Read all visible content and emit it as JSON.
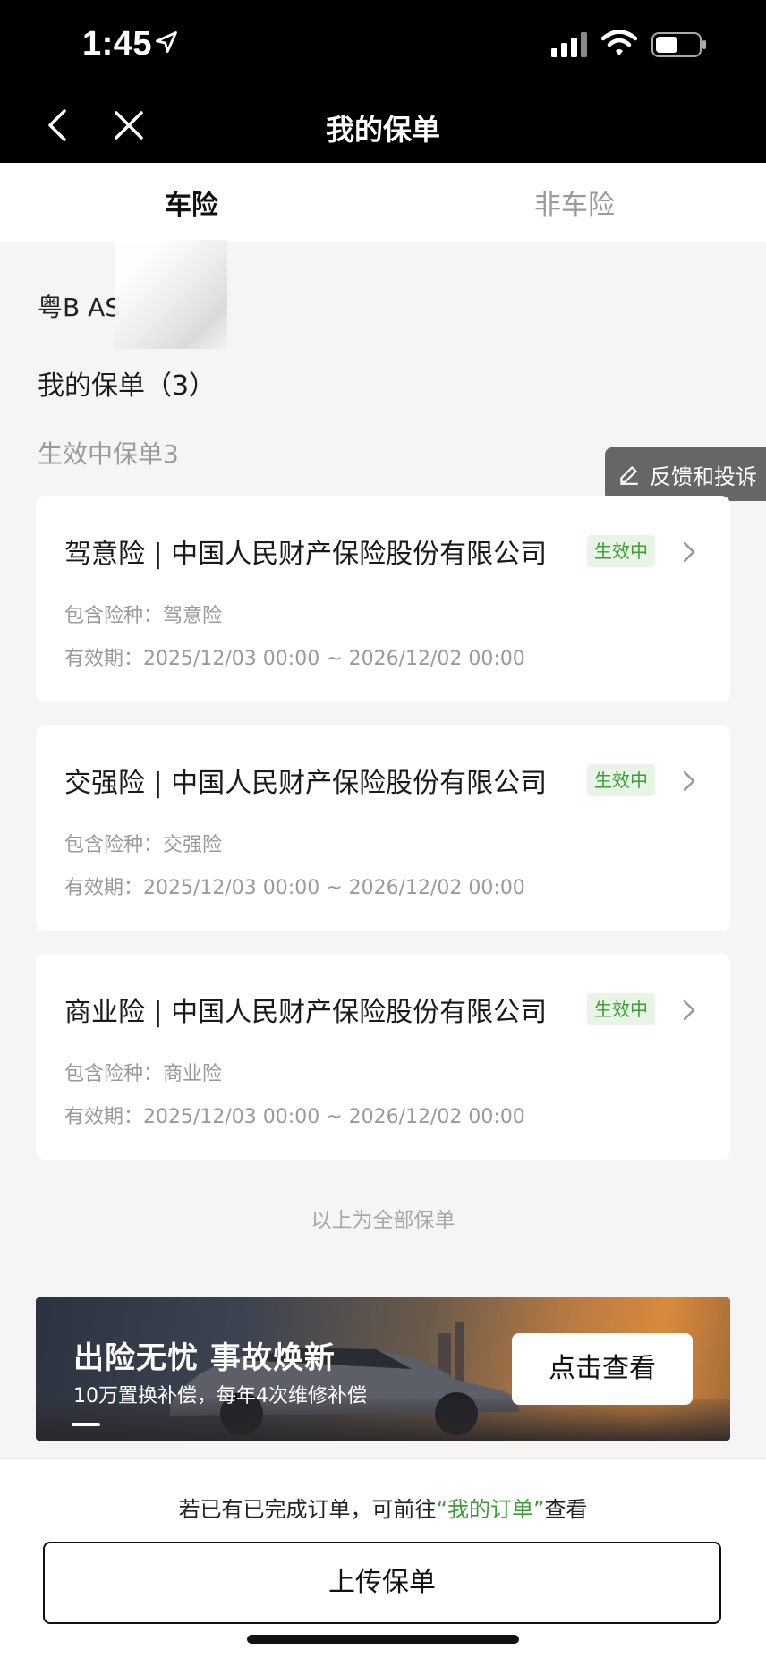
{
  "status_bar": {
    "time": "1:45",
    "icons": [
      "location-arrow-icon",
      "signal-icon",
      "wifi-icon",
      "battery-icon"
    ]
  },
  "nav": {
    "title": "我的保单",
    "back_icon": "chevron-left-icon",
    "close_icon": "close-icon"
  },
  "tabs": [
    {
      "label": "车险",
      "active": true
    },
    {
      "label": "非车险",
      "active": false
    }
  ],
  "header": {
    "plate": "粤B AS",
    "my_policies": "我的保单（3）",
    "active_count": "生效中保单3"
  },
  "feedback": {
    "label": "反馈和投诉",
    "icon": "edit-icon"
  },
  "policies": [
    {
      "title": "驾意险 | 中国人民财产保险股份有限公司",
      "badge": "生效中",
      "coverage": "包含险种：驾意险",
      "period": "有效期：2025/12/03 00:00 ~ 2026/12/02 00:00"
    },
    {
      "title": "交强险 | 中国人民财产保险股份有限公司",
      "badge": "生效中",
      "coverage": "包含险种：交强险",
      "period": "有效期：2025/12/03 00:00 ~ 2026/12/02 00:00"
    },
    {
      "title": "商业险 | 中国人民财产保险股份有限公司",
      "badge": "生效中",
      "coverage": "包含险种：商业险",
      "period": "有效期：2025/12/03 00:00 ~ 2026/12/02 00:00"
    }
  ],
  "list_end": "以上为全部保单",
  "banner": {
    "title": "出险无忧 事故焕新",
    "subtitle": "10万置换补偿，每年4次维修补偿",
    "button": "点击查看"
  },
  "bottom": {
    "hint_prefix": "若已有已完成订单，可前往",
    "hint_link": "“我的订单”",
    "hint_suffix": "查看",
    "upload_button": "上传保单"
  },
  "colors": {
    "accent_green": "#3f9a3a",
    "badge_bg": "#e8f5e6",
    "header_bg": "#000000",
    "page_bg": "#f5f5f5"
  }
}
